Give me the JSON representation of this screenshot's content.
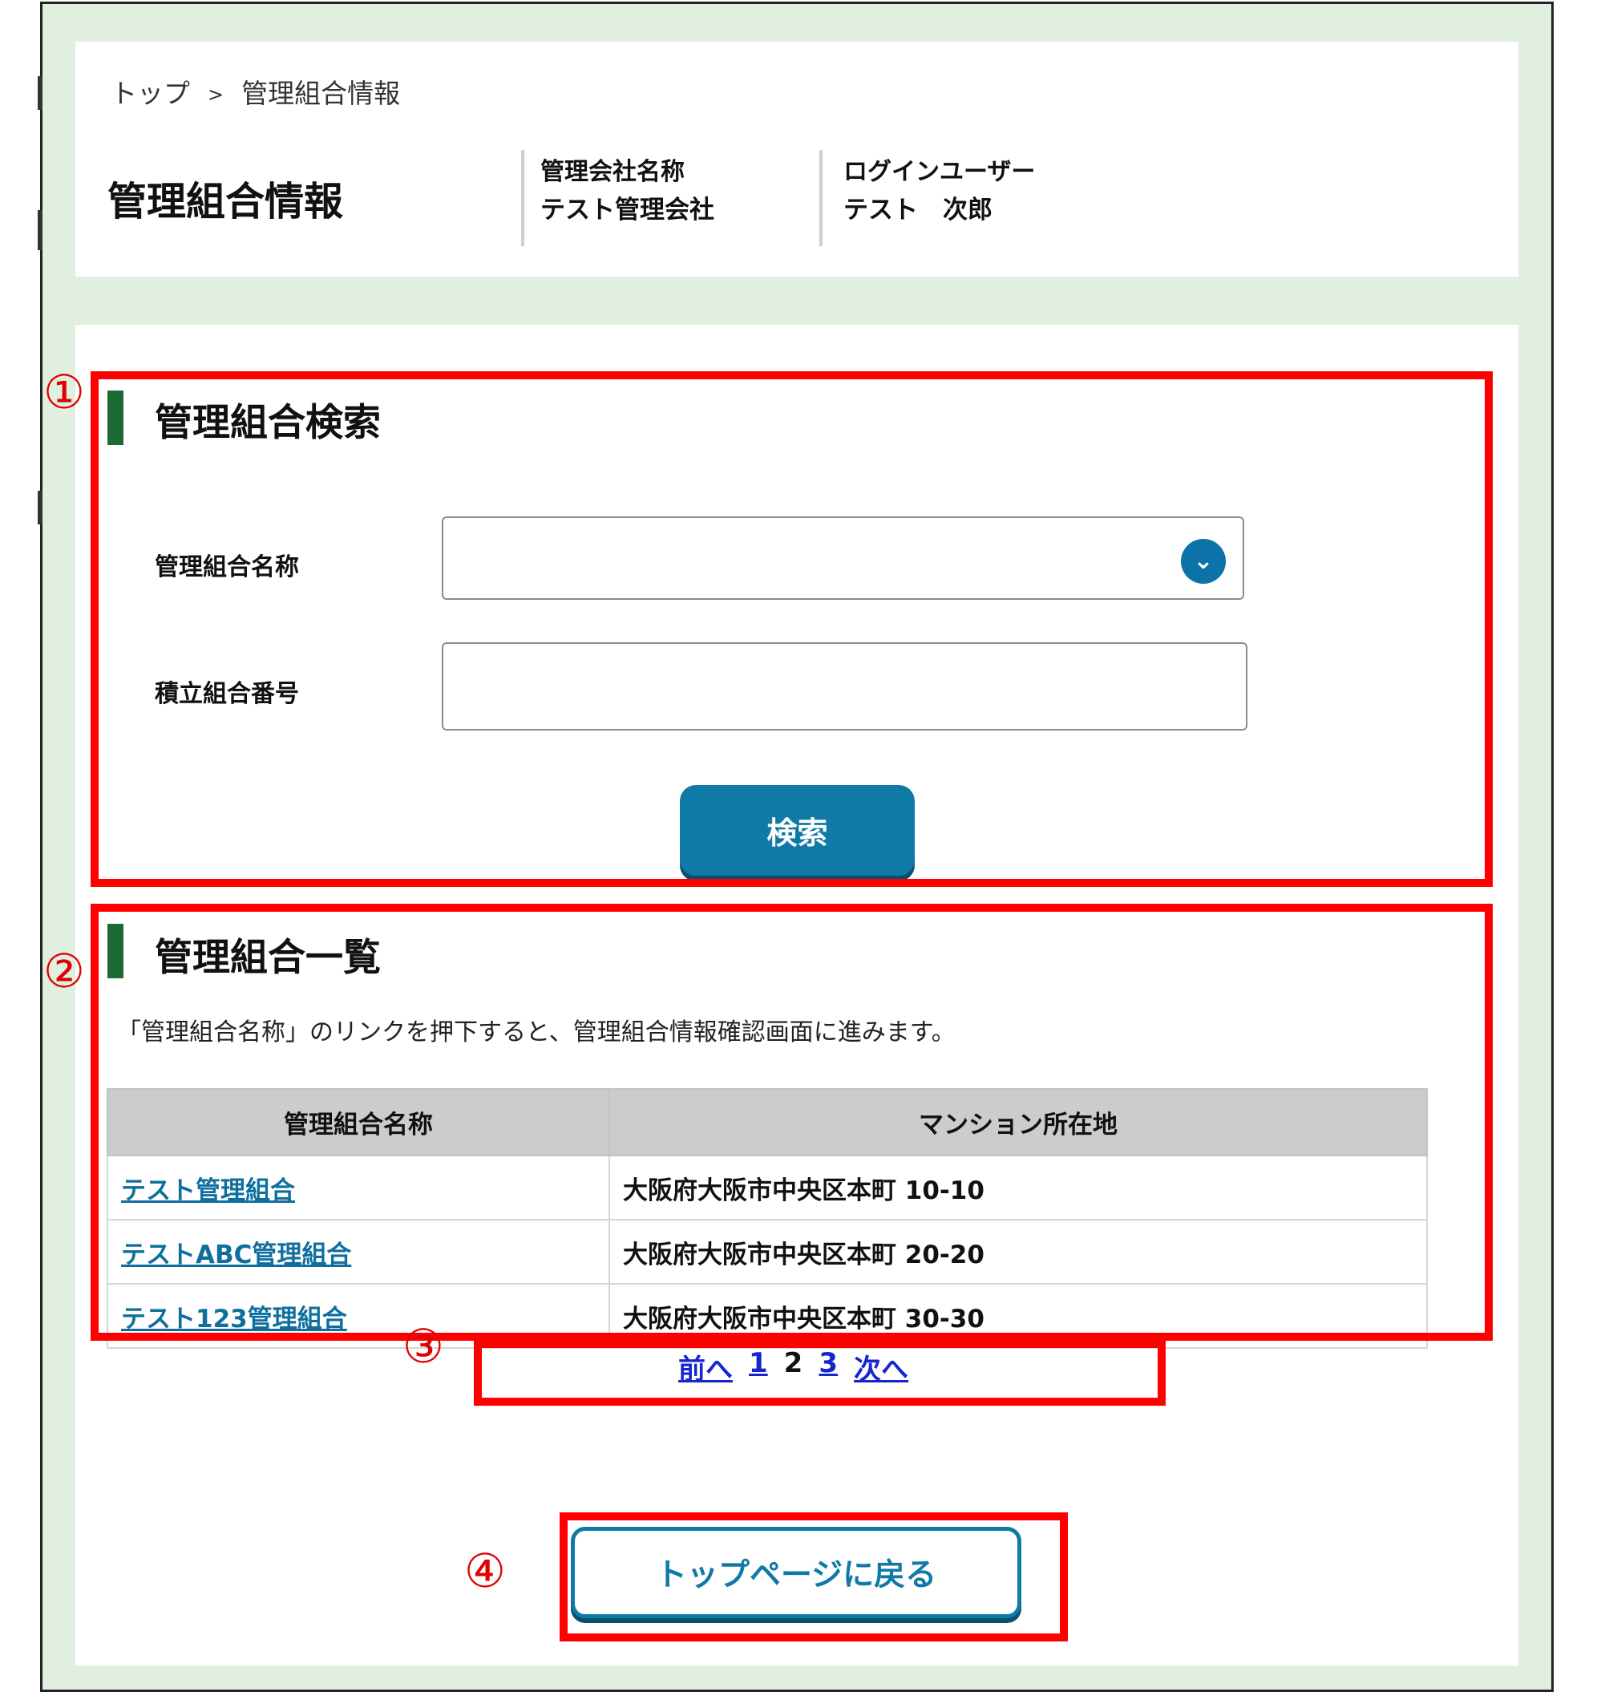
{
  "breadcrumb": {
    "home": "トップ",
    "separator": ">",
    "current": "管理組合情報"
  },
  "header": {
    "title": "管理組合情報",
    "company_label": "管理会社名称",
    "company_value": "テスト管理会社",
    "user_label": "ログインユーザー",
    "user_value": "テスト　次郎"
  },
  "search": {
    "section_title": "管理組合検索",
    "name_label": "管理組合名称",
    "name_value": "",
    "number_label": "積立組合番号",
    "number_value": "",
    "button_label": "検索"
  },
  "list": {
    "section_title": "管理組合一覧",
    "description": "「管理組合名称」のリンクを押下すると、管理組合情報確認画面に進みます。",
    "columns": [
      "管理組合名称",
      "マンション所在地"
    ],
    "rows": [
      {
        "name": "テスト管理組合",
        "address": "大阪府大阪市中央区本町 10-10"
      },
      {
        "name": "テストABC管理組合",
        "address": "大阪府大阪市中央区本町 20-20"
      },
      {
        "name": "テスト123管理組合",
        "address": "大阪府大阪市中央区本町 30-30"
      }
    ]
  },
  "pagination": {
    "prev": "前へ",
    "pages": [
      "1",
      "2",
      "3"
    ],
    "current": "2",
    "next": "次へ"
  },
  "back_button": "トップページに戻る",
  "markers": [
    "①",
    "②",
    "③",
    "④"
  ],
  "colors": {
    "accent": "#0f7aa6",
    "section_bar": "#1e6a34",
    "background": "#e0efdf",
    "annotation": "#ff0000",
    "link": "#0e6f9e"
  },
  "icons": {
    "select_toggle": "chevron-down-icon"
  }
}
